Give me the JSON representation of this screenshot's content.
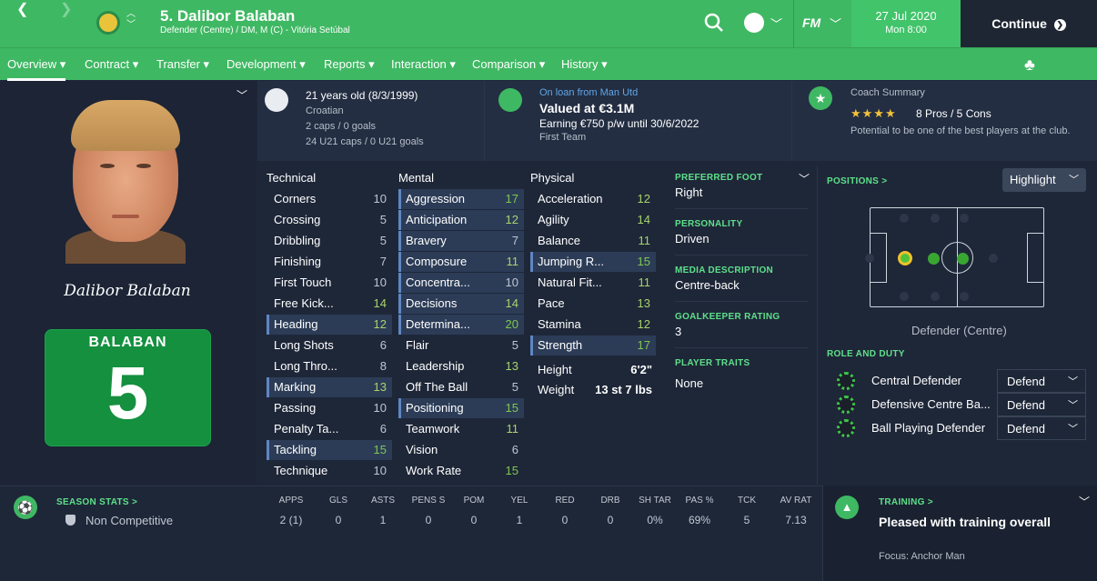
{
  "header": {
    "title": "5. Dalibor Balaban",
    "subtitle": "Defender (Centre) / DM, M (C) - Vitória Setúbal",
    "date": "27 Jul 2020",
    "time": "Mon 8:00",
    "continue_label": "Continue",
    "fm_label": "FM"
  },
  "nav": [
    "Overview",
    "Contract",
    "Transfer",
    "Development",
    "Reports",
    "Interaction",
    "Comparison",
    "History"
  ],
  "profile": {
    "age": "21 years old (8/3/1999)",
    "nationality": "Croatian",
    "caps": "2 caps / 0 goals",
    "u21caps": "24 U21 caps / 0 U21 goals",
    "loan": "On loan from Man Utd",
    "value": "Valued at €3.1M",
    "wage": "Earning €750 p/w until 30/6/2022",
    "squad": "First Team",
    "coach_title": "Coach Summary",
    "stars": "★★★★",
    "pros_cons": "8 Pros / 5 Cons",
    "potential": "Potential to be one of the best players at the club.",
    "signature": "Dalibor Balaban",
    "shirt_name": "BALABAN",
    "shirt_number": "5"
  },
  "attributes": {
    "technical_title": "Technical",
    "mental_title": "Mental",
    "physical_title": "Physical",
    "technical": [
      {
        "name": "Corners",
        "value": "10"
      },
      {
        "name": "Crossing",
        "value": "5"
      },
      {
        "name": "Dribbling",
        "value": "5"
      },
      {
        "name": "Finishing",
        "value": "7"
      },
      {
        "name": "First Touch",
        "value": "10"
      },
      {
        "name": "Free Kick...",
        "value": "14"
      },
      {
        "name": "Heading",
        "value": "12"
      },
      {
        "name": "Long Shots",
        "value": "6"
      },
      {
        "name": "Long Thro...",
        "value": "8"
      },
      {
        "name": "Marking",
        "value": "13"
      },
      {
        "name": "Passing",
        "value": "10"
      },
      {
        "name": "Penalty Ta...",
        "value": "6"
      },
      {
        "name": "Tackling",
        "value": "15"
      },
      {
        "name": "Technique",
        "value": "10"
      }
    ],
    "mental": [
      {
        "name": "Aggression",
        "value": "17"
      },
      {
        "name": "Anticipation",
        "value": "12"
      },
      {
        "name": "Bravery",
        "value": "7"
      },
      {
        "name": "Composure",
        "value": "11"
      },
      {
        "name": "Concentra...",
        "value": "10"
      },
      {
        "name": "Decisions",
        "value": "14"
      },
      {
        "name": "Determina...",
        "value": "20"
      },
      {
        "name": "Flair",
        "value": "5"
      },
      {
        "name": "Leadership",
        "value": "13"
      },
      {
        "name": "Off The Ball",
        "value": "5"
      },
      {
        "name": "Positioning",
        "value": "15"
      },
      {
        "name": "Teamwork",
        "value": "11"
      },
      {
        "name": "Vision",
        "value": "6"
      },
      {
        "name": "Work Rate",
        "value": "15"
      }
    ],
    "physical": [
      {
        "name": "Acceleration",
        "value": "12"
      },
      {
        "name": "Agility",
        "value": "14"
      },
      {
        "name": "Balance",
        "value": "11"
      },
      {
        "name": "Jumping R...",
        "value": "15"
      },
      {
        "name": "Natural Fit...",
        "value": "11"
      },
      {
        "name": "Pace",
        "value": "13"
      },
      {
        "name": "Stamina",
        "value": "12"
      },
      {
        "name": "Strength",
        "value": "17"
      }
    ],
    "height_label": "Height",
    "height": "6'2\"",
    "weight_label": "Weight",
    "weight": "13 st 7 lbs"
  },
  "details": {
    "foot_label": "PREFERRED FOOT",
    "foot": "Right",
    "personality_label": "PERSONALITY",
    "personality": "Driven",
    "media_label": "MEDIA DESCRIPTION",
    "media": "Centre-back",
    "gk_label": "GOALKEEPER RATING",
    "gk": "3",
    "traits_label": "PLAYER TRAITS",
    "traits": "None"
  },
  "positions": {
    "title": "POSITIONS >",
    "highlight": "Highlight",
    "position_name": "Defender (Centre)",
    "roles_title": "ROLE AND DUTY",
    "roles": [
      {
        "name": "Central Defender",
        "duty": "Defend"
      },
      {
        "name": "Defensive Centre Ba...",
        "duty": "Defend"
      },
      {
        "name": "Ball Playing Defender",
        "duty": "Defend"
      }
    ]
  },
  "season": {
    "title": "SEASON STATS >",
    "competition": "Non Competitive",
    "headers": [
      "APPS",
      "GLS",
      "ASTS",
      "PENS S",
      "POM",
      "YEL",
      "RED",
      "DRB",
      "SH TAR",
      "PAS %",
      "TCK",
      "AV RAT"
    ],
    "values": [
      "2 (1)",
      "0",
      "1",
      "0",
      "0",
      "1",
      "0",
      "0",
      "0%",
      "69%",
      "5",
      "7.13"
    ]
  },
  "training": {
    "title": "TRAINING >",
    "status": "Pleased with training overall",
    "focus": "Focus: Anchor Man"
  }
}
